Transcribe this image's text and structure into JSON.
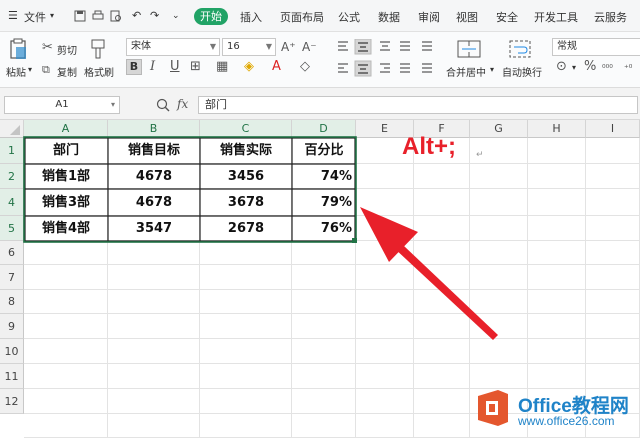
{
  "menubar": {
    "file": "文件",
    "tabs": [
      "开始",
      "插入",
      "页面布局",
      "公式",
      "数据",
      "审阅",
      "视图",
      "安全",
      "开发工具",
      "云服务"
    ]
  },
  "ribbon": {
    "paste": "粘贴",
    "cut": "剪切",
    "copy": "复制",
    "format_painter": "格式刷",
    "font_name": "宋体",
    "font_size": "16",
    "merge_center": "合并居中",
    "wrap_text": "自动换行",
    "number_format": "常规",
    "percent": "%",
    "bold": "B",
    "italic": "I",
    "underline": "U"
  },
  "formula_bar": {
    "name_box": "A1",
    "fx": "fx",
    "content": "部门"
  },
  "sheet": {
    "columns": [
      "A",
      "B",
      "C",
      "D",
      "E",
      "F",
      "G",
      "H",
      "I"
    ],
    "rows": [
      "1",
      "2",
      "4",
      "5",
      "6",
      "7",
      "8",
      "9",
      "10",
      "11",
      "12"
    ],
    "table": {
      "header": [
        "部门",
        "销售目标",
        "销售实际",
        "百分比"
      ],
      "rows": [
        [
          "销售1部",
          "4678",
          "3456",
          "74%"
        ],
        [
          "销售3部",
          "4678",
          "3678",
          "79%"
        ],
        [
          "销售4部",
          "3547",
          "2678",
          "76%"
        ]
      ]
    }
  },
  "annotation": {
    "shortcut": "Alt+;",
    "return_mark": "↵",
    "color": "#e8202a"
  },
  "watermark": {
    "brand": "Office教程网",
    "url": "www.office26.com"
  },
  "colors": {
    "accent": "#21a366",
    "selection": "#217346"
  }
}
